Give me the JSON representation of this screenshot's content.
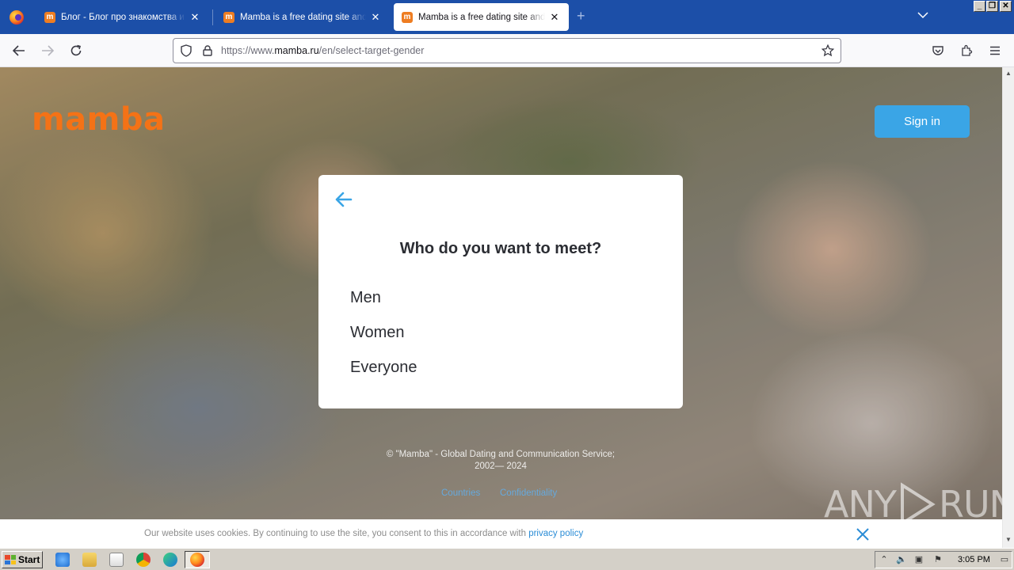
{
  "browser": {
    "tabs": [
      {
        "title": "Блог - Блог про знакомства и отн",
        "favicon": "m",
        "active": false
      },
      {
        "title": "Mamba is a free dating site and a c",
        "favicon": "m",
        "active": false
      },
      {
        "title": "Mamba is a free dating site and a c",
        "favicon": "m",
        "active": true
      }
    ],
    "url_prefix": "https://www.",
    "url_domain": "mamba.ru",
    "url_path": "/en/select-target-gender"
  },
  "page": {
    "logo": "mamba",
    "sign_in": "Sign in",
    "question": "Who do you want to meet?",
    "options": [
      "Men",
      "Women",
      "Everyone"
    ],
    "footer_line1": "© \"Mamba\" - Global Dating and Communication Service;",
    "footer_line2": "2002— 2024",
    "link_countries": "Countries",
    "link_confidentiality": "Confidentiality",
    "watermark_left": "ANY",
    "watermark_right": "RUN"
  },
  "cookie": {
    "text": "Our website uses cookies. By continuing to use the site, you consent to this in accordance with ",
    "link": "privacy policy"
  },
  "taskbar": {
    "start": "Start",
    "clock": "3:05 PM"
  },
  "colors": {
    "brand": "#f47216",
    "accent": "#3aa5e6",
    "tabbar": "#1c4fa8"
  }
}
